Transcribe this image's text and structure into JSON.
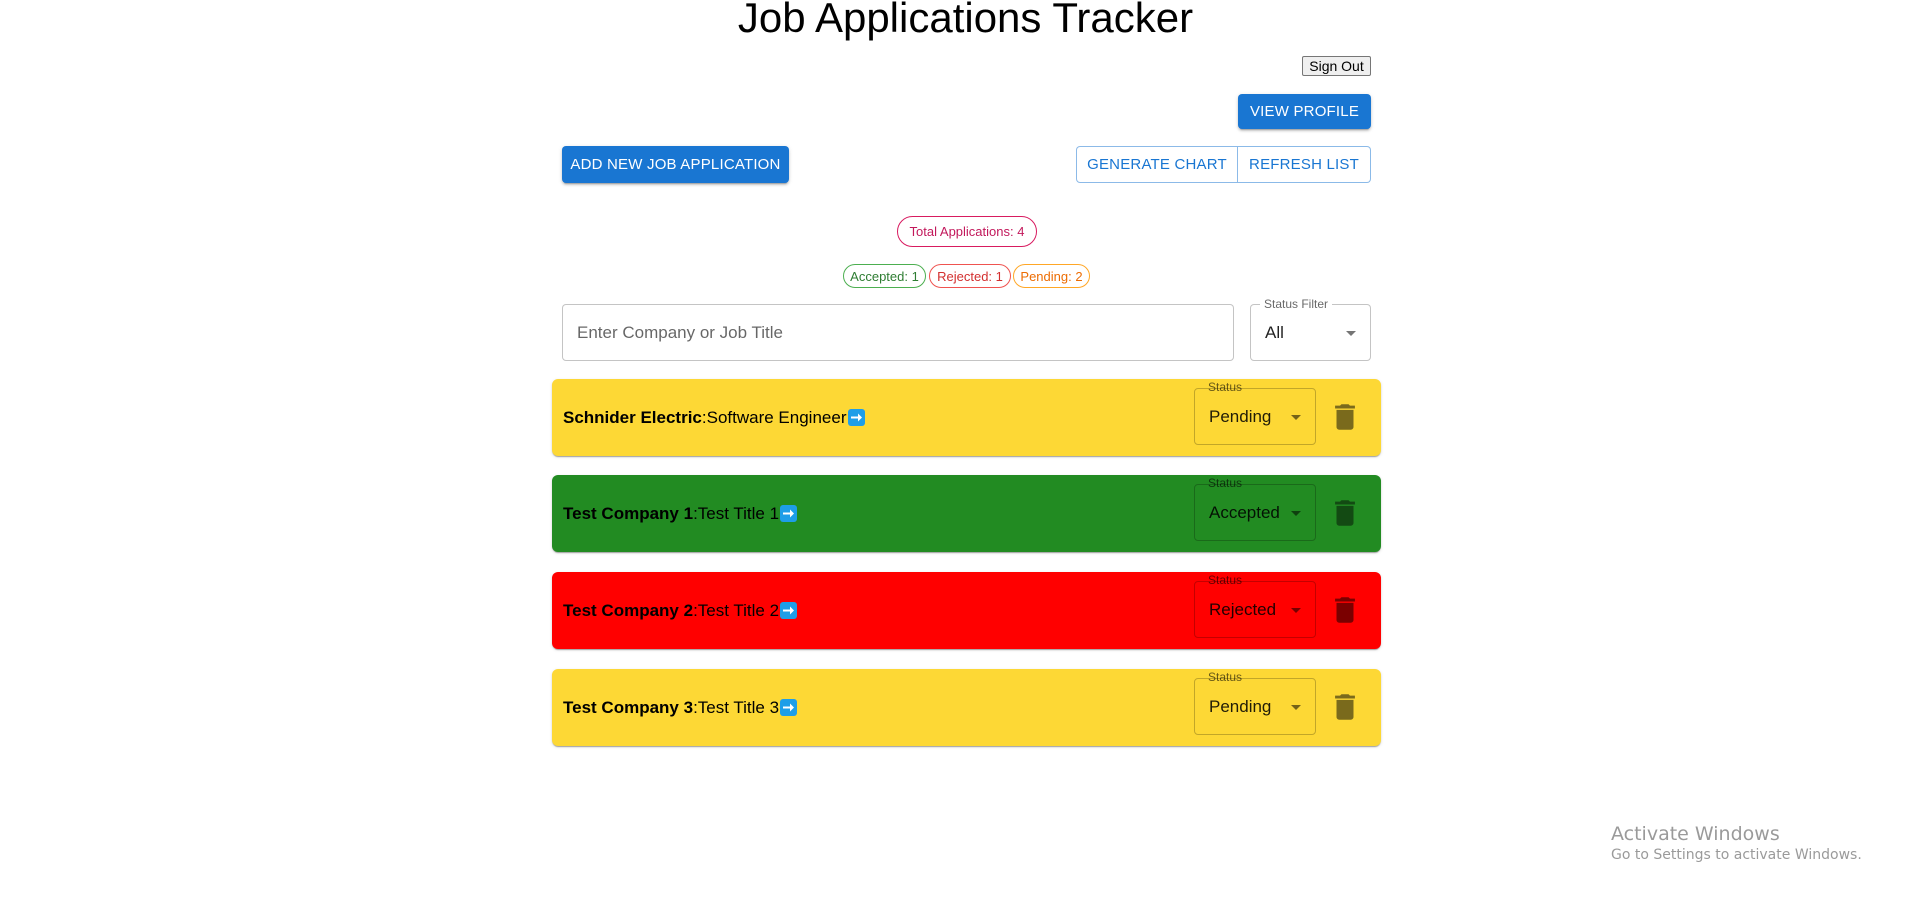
{
  "header": {
    "title": "Job Applications Tracker",
    "sign_out_label": "Sign Out"
  },
  "toolbar": {
    "view_profile_label": "VIEW PROFILE",
    "add_new_label": "ADD NEW JOB APPLICATION",
    "generate_chart_label": "GENERATE CHART",
    "refresh_list_label": "REFRESH LIST"
  },
  "summary": {
    "total_label": "Total Applications: 4",
    "accepted_label": "Accepted: 1",
    "rejected_label": "Rejected: 1",
    "pending_label": "Pending: 2"
  },
  "filters": {
    "search_placeholder": "Enter Company or Job Title",
    "status_filter_label": "Status Filter",
    "status_filter_value": "All"
  },
  "applications": [
    {
      "company": "Schnider Electric",
      "title": "Software Engineer",
      "status_label": "Status",
      "status": "Pending",
      "color": "#fdd835",
      "trash_color": "#7a6a1c",
      "icon": "right-arrow-icon"
    },
    {
      "company": "Test Company 1",
      "title": "Test Title 1",
      "status_label": "Status",
      "status": "Accepted",
      "color": "#228b22",
      "trash_color": "#134a13",
      "icon": "right-arrow-icon"
    },
    {
      "company": "Test Company 2",
      "title": "Test Title 2",
      "status_label": "Status",
      "status": "Rejected",
      "color": "#ff0000",
      "trash_color": "#7a0000",
      "icon": "right-arrow-icon"
    },
    {
      "company": "Test Company 3",
      "title": "Test Title 3",
      "status_label": "Status",
      "status": "Pending",
      "color": "#fdd835",
      "trash_color": "#7a6a1c",
      "icon": "right-arrow-icon"
    }
  ],
  "os_watermark": {
    "line1": "Activate Windows",
    "line2": "Go to Settings to activate Windows."
  },
  "colors": {
    "primary": "#1976d2",
    "pending": "#fdd835",
    "accepted": "#228b22",
    "rejected": "#ff0000",
    "total_chip": "#c2185b"
  }
}
